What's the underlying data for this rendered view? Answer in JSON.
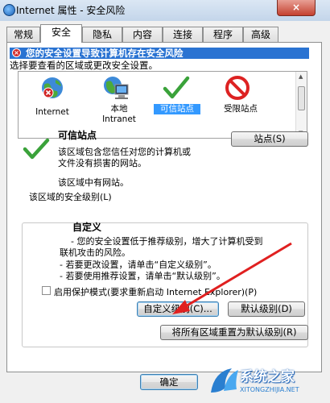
{
  "window": {
    "title": "Internet 属性 - 安全风险",
    "close": "×"
  },
  "tabs": [
    "常规",
    "安全",
    "隐私",
    "内容",
    "连接",
    "程序",
    "高级"
  ],
  "warning": "您的安全设置导致计算机存在安全风险",
  "select_zone_label": "选择要查看的区域或更改安全设置。",
  "zones": [
    "Internet",
    "本地 Intranet",
    "可信站点",
    "受限站点"
  ],
  "selected_zone": {
    "title": "可信站点",
    "description_lines": [
      "该区域包含您信任对您的计算机或",
      "文件没有损害的网站。"
    ],
    "has_sites": "该区域中有网站。",
    "sites_button": "站点(S)"
  },
  "security_level": {
    "label": "该区域的安全级别(L)",
    "title": "自定义",
    "lines": [
      "- 您的安全设置低于推荐级别，增大了计算机受到",
      "联机攻击的风险。",
      "- 若要更改设置，请单击“自定义级别”。",
      "- 若要使用推荐设置，请单击“默认级别”。"
    ]
  },
  "protected_mode": "启用保护模式(要求重新启动 Internet Explorer)(P)",
  "buttons": {
    "custom_level": "自定义级别(C)...",
    "default_level": "默认级别(D)",
    "reset_all": "将所有区域重置为默认级别(R)",
    "ok": "确定"
  },
  "watermark": {
    "brand": "系统之家",
    "url": "XITONGZHIJIA.NET"
  },
  "colors": {
    "warning_bar": "#2a73d2",
    "arrow": "#e02020",
    "check": "#3aa23a"
  }
}
